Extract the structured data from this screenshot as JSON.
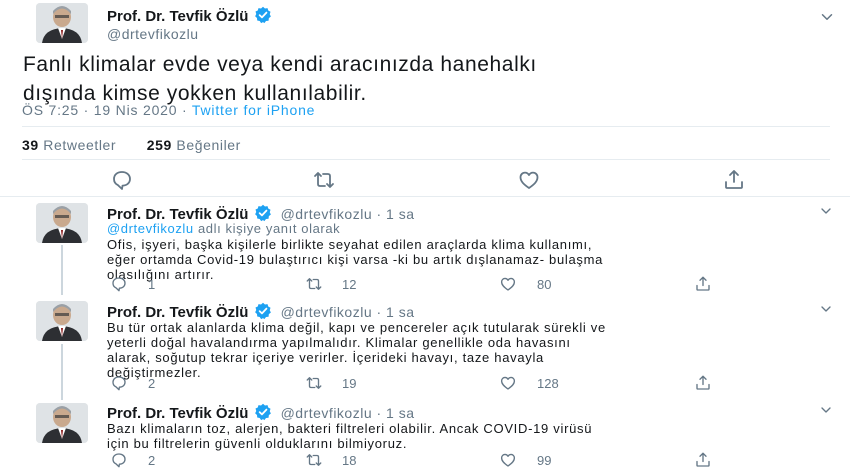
{
  "main_tweet": {
    "author_name": "Prof. Dr. Tevfik Özlü",
    "author_handle": "@drtevfikozlu",
    "text_line1": "Fanlı klimalar evde veya kendi aracınızda hanehalkı",
    "text_line2": "dışında kimse yokken kullanılabilir.",
    "time": "ÖS 7:25 · 19 Nis 2020 · ",
    "source": "Twitter for iPhone",
    "retweets_count": "39",
    "retweets_label": "Retweetler",
    "likes_count": "259",
    "likes_label": "Beğeniler"
  },
  "replies": [
    {
      "author_name": "Prof. Dr. Tevfik Özlü",
      "author_handle": "@drtevfikozlu · 1 sa",
      "replying_handle": "@drtevfikozlu",
      "replying_suffix": " adlı kişiye yanıt olarak",
      "text_lines": [
        "Ofis, işyeri, başka kişilerle birlikte seyahat edilen araçlarda klima kullanımı,",
        "eğer ortamda Covid-19 bulaştırıcı kişi varsa -ki bu artık dışlanamaz- bulaşma",
        "olasılığını artırır."
      ],
      "replies_count": "1",
      "retweets_count": "12",
      "likes_count": "80"
    },
    {
      "author_name": "Prof. Dr. Tevfik Özlü",
      "author_handle": "@drtevfikozlu · 1 sa",
      "text_lines": [
        "Bu tür ortak alanlarda klima değil, kapı ve pencereler açık tutularak sürekli ve",
        "yeterli doğal havalandırma yapılmalıdır. Klimalar genellikle oda havasını",
        "alarak, soğutup tekrar içeriye verirler.  İçerideki havayı, taze havayla",
        "değiştirmezler."
      ],
      "replies_count": "2",
      "retweets_count": "19",
      "likes_count": "128"
    },
    {
      "author_name": "Prof. Dr. Tevfik Özlü",
      "author_handle": "@drtevfikozlu · 1 sa",
      "text_lines": [
        "Bazı klimaların toz, alerjen, bakteri filtreleri olabilir. Ancak COVID-19 virüsü",
        "için bu filtrelerin güvenli olduklarını bilmiyoruz."
      ],
      "replies_count": "2",
      "retweets_count": "18",
      "likes_count": "99"
    }
  ],
  "icons": {
    "verified": "verified-badge-icon",
    "reply": "reply-icon",
    "retweet": "retweet-icon",
    "like": "like-icon",
    "share": "share-icon",
    "more": "chevron-down-icon"
  },
  "colors": {
    "accent": "#1da1f2",
    "text": "#14171a",
    "muted": "#657786",
    "divider": "#e6ecf0"
  }
}
